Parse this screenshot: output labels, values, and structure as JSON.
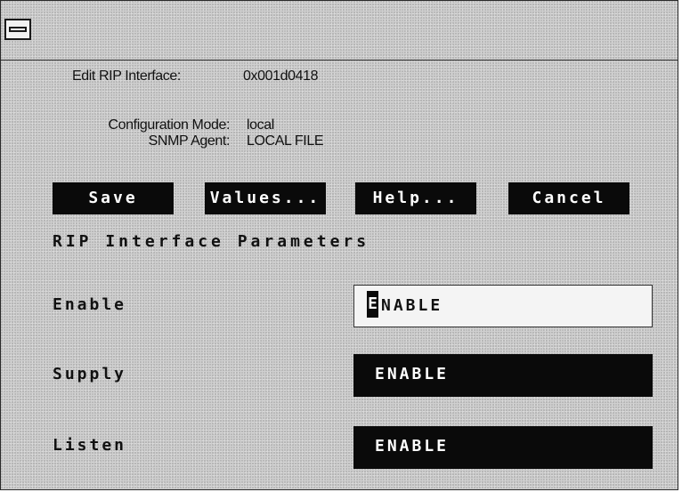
{
  "header": {
    "edit_label": "Edit RIP Interface:",
    "edit_value": "0x001d0418",
    "config_mode_label": "Configuration Mode:",
    "config_mode_value": "local",
    "snmp_agent_label": "SNMP Agent:",
    "snmp_agent_value": "LOCAL FILE"
  },
  "toolbar": {
    "save_label": "Save",
    "values_label": "Values...",
    "help_label": "Help...",
    "cancel_label": "Cancel"
  },
  "section": {
    "title": "RIP Interface Parameters"
  },
  "params": {
    "enable": {
      "label": "Enable",
      "value_first": "E",
      "value_rest": "NABLE"
    },
    "supply": {
      "label": "Supply",
      "value": "ENABLE"
    },
    "listen": {
      "label": "Listen",
      "value": "ENABLE"
    }
  },
  "icons": {
    "window_menu": "window-menu-icon"
  }
}
